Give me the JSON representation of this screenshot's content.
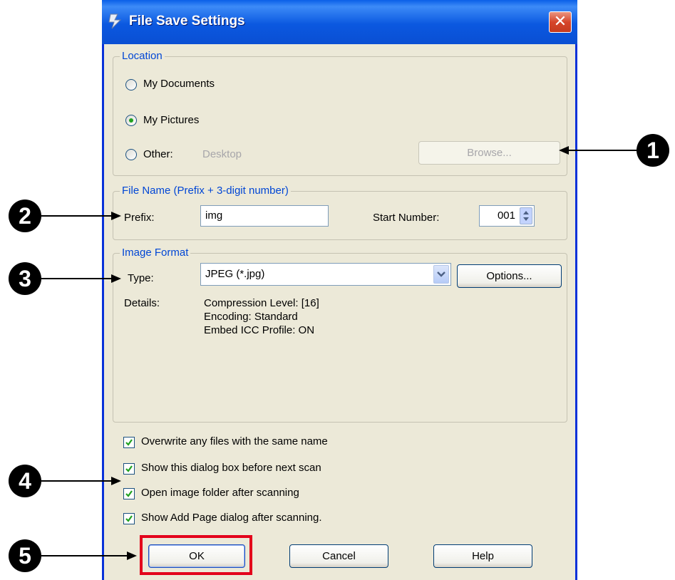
{
  "window": {
    "title": "File Save Settings",
    "close_label": "✕"
  },
  "location": {
    "legend": "Location",
    "options": [
      {
        "label": "My Documents",
        "selected": false
      },
      {
        "label": "My Pictures",
        "selected": true
      },
      {
        "label": "Other:",
        "selected": false
      }
    ],
    "other_value": "Desktop",
    "browse_label": "Browse..."
  },
  "file_name": {
    "legend": "File Name (Prefix + 3-digit number)",
    "prefix_label": "Prefix:",
    "prefix_value": "img",
    "start_number_label": "Start Number:",
    "start_number_value": "001"
  },
  "image_format": {
    "legend": "Image Format",
    "type_label": "Type:",
    "type_value": "JPEG (*.jpg)",
    "options_label": "Options...",
    "details_label": "Details:",
    "details_lines": [
      "Compression Level: [16]",
      "Encoding: Standard",
      "Embed ICC Profile: ON"
    ]
  },
  "checkboxes": [
    {
      "label": "Overwrite any files with the same name",
      "checked": true
    },
    {
      "label": "Show this dialog box before next scan",
      "checked": true
    },
    {
      "label": "Open image folder after scanning",
      "checked": true
    },
    {
      "label": "Show Add Page dialog after scanning.",
      "checked": true
    }
  ],
  "buttons": {
    "ok": "OK",
    "cancel": "Cancel",
    "help": "Help"
  },
  "callouts": [
    "1",
    "2",
    "3",
    "4",
    "5"
  ],
  "colors": {
    "titlebar": "#0a5fe8",
    "legend": "#0046d5",
    "highlight": "#e3001b",
    "dialog_bg": "#ece9d8"
  }
}
